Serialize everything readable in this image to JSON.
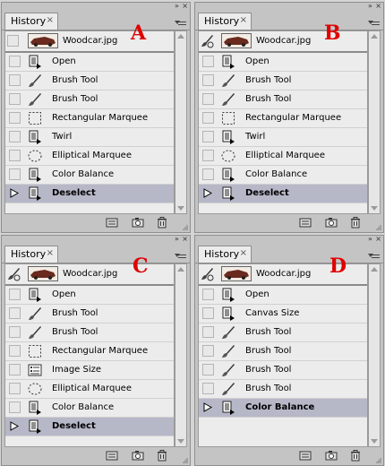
{
  "panels": [
    {
      "id": "A",
      "label": "A",
      "tab_title": "History",
      "snapshot": "Woodcar.jpg",
      "show_brush_icon": false,
      "steps": [
        {
          "label": "Open",
          "icon": "document-icon"
        },
        {
          "label": "Brush Tool",
          "icon": "brush-icon"
        },
        {
          "label": "Brush Tool",
          "icon": "brush-icon"
        },
        {
          "label": "Rectangular Marquee",
          "icon": "rect-marquee-icon"
        },
        {
          "label": "Twirl",
          "icon": "document-icon"
        },
        {
          "label": "Elliptical Marquee",
          "icon": "ellipse-marquee-icon"
        },
        {
          "label": "Color Balance",
          "icon": "document-icon"
        },
        {
          "label": "Deselect",
          "icon": "document-icon",
          "selected": true
        }
      ]
    },
    {
      "id": "B",
      "label": "B",
      "tab_title": "History",
      "snapshot": "Woodcar.jpg",
      "show_brush_icon": true,
      "steps": [
        {
          "label": "Open",
          "icon": "document-icon"
        },
        {
          "label": "Brush Tool",
          "icon": "brush-icon"
        },
        {
          "label": "Brush Tool",
          "icon": "brush-icon"
        },
        {
          "label": "Rectangular Marquee",
          "icon": "rect-marquee-icon"
        },
        {
          "label": "Twirl",
          "icon": "document-icon"
        },
        {
          "label": "Elliptical Marquee",
          "icon": "ellipse-marquee-icon"
        },
        {
          "label": "Color Balance",
          "icon": "document-icon"
        },
        {
          "label": "Deselect",
          "icon": "document-icon",
          "selected": true
        }
      ]
    },
    {
      "id": "C",
      "label": "C",
      "tab_title": "History",
      "snapshot": "Woodcar.jpg",
      "show_brush_icon": true,
      "steps": [
        {
          "label": "Open",
          "icon": "document-icon"
        },
        {
          "label": "Brush Tool",
          "icon": "brush-icon"
        },
        {
          "label": "Brush Tool",
          "icon": "brush-icon"
        },
        {
          "label": "Rectangular Marquee",
          "icon": "rect-marquee-icon"
        },
        {
          "label": "Image Size",
          "icon": "image-size-icon"
        },
        {
          "label": "Elliptical Marquee",
          "icon": "ellipse-marquee-icon"
        },
        {
          "label": "Color Balance",
          "icon": "document-icon"
        },
        {
          "label": "Deselect",
          "icon": "document-icon",
          "selected": true
        }
      ]
    },
    {
      "id": "D",
      "label": "D",
      "tab_title": "History",
      "snapshot": "Woodcar.jpg",
      "show_brush_icon": true,
      "steps": [
        {
          "label": "Open",
          "icon": "document-icon"
        },
        {
          "label": "Canvas Size",
          "icon": "document-icon"
        },
        {
          "label": "Brush Tool",
          "icon": "brush-icon"
        },
        {
          "label": "Brush Tool",
          "icon": "brush-icon"
        },
        {
          "label": "Brush Tool",
          "icon": "brush-icon"
        },
        {
          "label": "Brush Tool",
          "icon": "brush-icon"
        },
        {
          "label": "Color Balance",
          "icon": "document-icon",
          "selected": true
        }
      ]
    }
  ],
  "colors": {
    "letter": "#e00000",
    "selected_row": "#b6b8c8",
    "row_bg": "#ececec"
  }
}
